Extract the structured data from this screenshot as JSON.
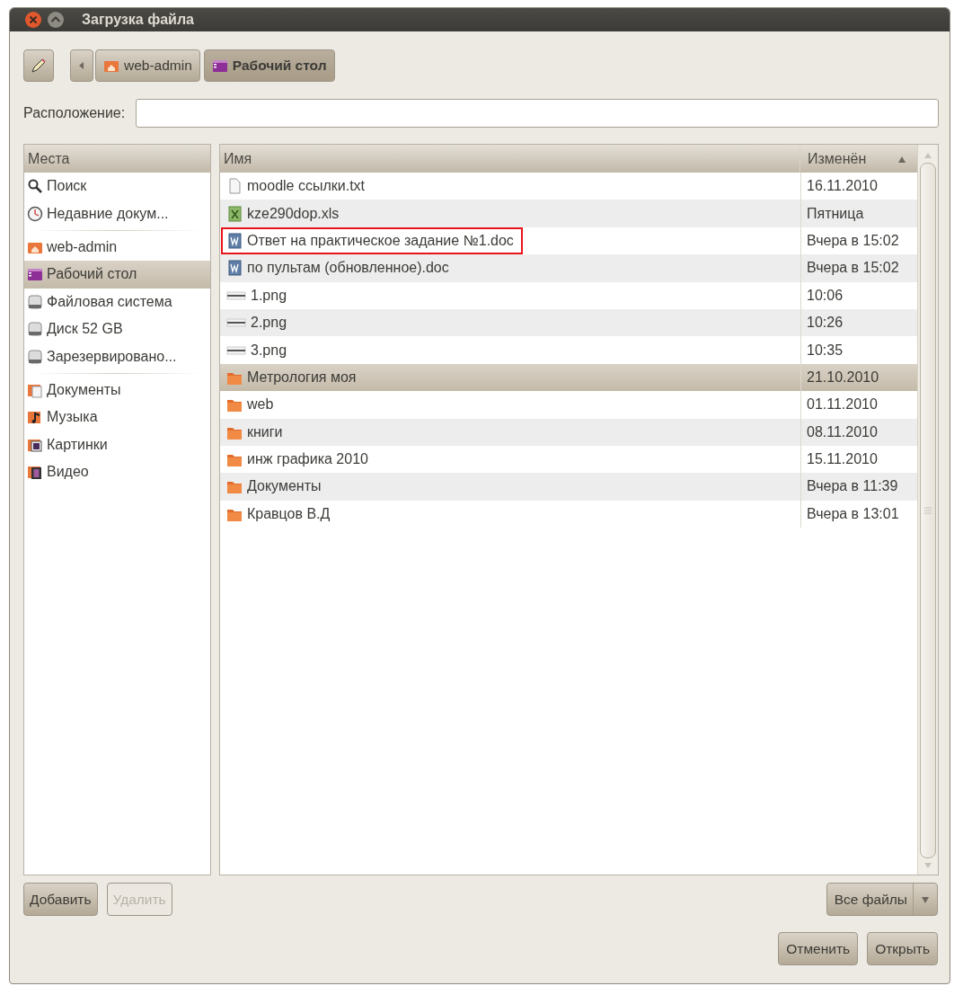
{
  "window": {
    "title": "Загрузка файла"
  },
  "path_bar": {
    "segments": [
      {
        "label": "web-admin",
        "kind": "home",
        "selected": false
      },
      {
        "label": "Рабочий стол",
        "kind": "desktop",
        "selected": true
      }
    ]
  },
  "location": {
    "label": "Расположение:"
  },
  "places": {
    "header": "Места",
    "groups": [
      [
        {
          "label": "Поиск",
          "kind": "search",
          "selected": false
        },
        {
          "label": "Недавние докум...",
          "kind": "recent",
          "selected": false
        }
      ],
      [
        {
          "label": "web-admin",
          "kind": "home",
          "selected": false
        },
        {
          "label": "Рабочий стол",
          "kind": "desktop",
          "selected": true
        },
        {
          "label": "Файловая система",
          "kind": "drive",
          "selected": false
        },
        {
          "label": "Диск 52 GB",
          "kind": "drive",
          "selected": false
        },
        {
          "label": "Зарезервировано...",
          "kind": "drive",
          "selected": false
        }
      ],
      [
        {
          "label": "Документы",
          "kind": "documents",
          "selected": false
        },
        {
          "label": "Музыка",
          "kind": "music",
          "selected": false
        },
        {
          "label": "Картинки",
          "kind": "pictures",
          "selected": false
        },
        {
          "label": "Видео",
          "kind": "video",
          "selected": false
        }
      ]
    ]
  },
  "files": {
    "columns": [
      {
        "label": "Имя",
        "sorted": false
      },
      {
        "label": "Изменён",
        "sorted": true
      }
    ],
    "rows": [
      {
        "name": "moodle ссылки.txt",
        "modified": "16.11.2010",
        "kind": "text",
        "selected": false,
        "outlined": false
      },
      {
        "name": "kze290dop.xls",
        "modified": "Пятница",
        "kind": "spreadsheet",
        "selected": false,
        "outlined": false
      },
      {
        "name": "Ответ на практическое задание №1.doc",
        "modified": "Вчера в 15:02",
        "kind": "document",
        "selected": false,
        "outlined": true
      },
      {
        "name": "по пультам (обновленное).doc",
        "modified": "Вчера в 15:02",
        "kind": "document",
        "selected": false,
        "outlined": false
      },
      {
        "name": "1.png",
        "modified": "10:06",
        "kind": "image",
        "selected": false,
        "outlined": false
      },
      {
        "name": "2.png",
        "modified": "10:26",
        "kind": "image",
        "selected": false,
        "outlined": false
      },
      {
        "name": "3.png",
        "modified": "10:35",
        "kind": "image",
        "selected": false,
        "outlined": false
      },
      {
        "name": "Метрология моя",
        "modified": "21.10.2010",
        "kind": "folder",
        "selected": true,
        "outlined": false
      },
      {
        "name": "web",
        "modified": "01.11.2010",
        "kind": "folder",
        "selected": false,
        "outlined": false
      },
      {
        "name": "книги",
        "modified": "08.11.2010",
        "kind": "folder",
        "selected": false,
        "outlined": false
      },
      {
        "name": "инж графика 2010",
        "modified": "15.11.2010",
        "kind": "folder",
        "selected": false,
        "outlined": false
      },
      {
        "name": "Документы",
        "modified": "Вчера в 11:39",
        "kind": "folder",
        "selected": false,
        "outlined": false
      },
      {
        "name": "Кравцов В.Д",
        "modified": "Вчера в 13:01",
        "kind": "folder",
        "selected": false,
        "outlined": false
      }
    ]
  },
  "places_buttons": [
    {
      "label": "Добавить",
      "disabled": false
    },
    {
      "label": "Удалить",
      "disabled": true
    }
  ],
  "filter": {
    "value": "Все файлы"
  },
  "buttons": [
    {
      "label": "Отменить"
    },
    {
      "label": "Открыть"
    }
  ]
}
